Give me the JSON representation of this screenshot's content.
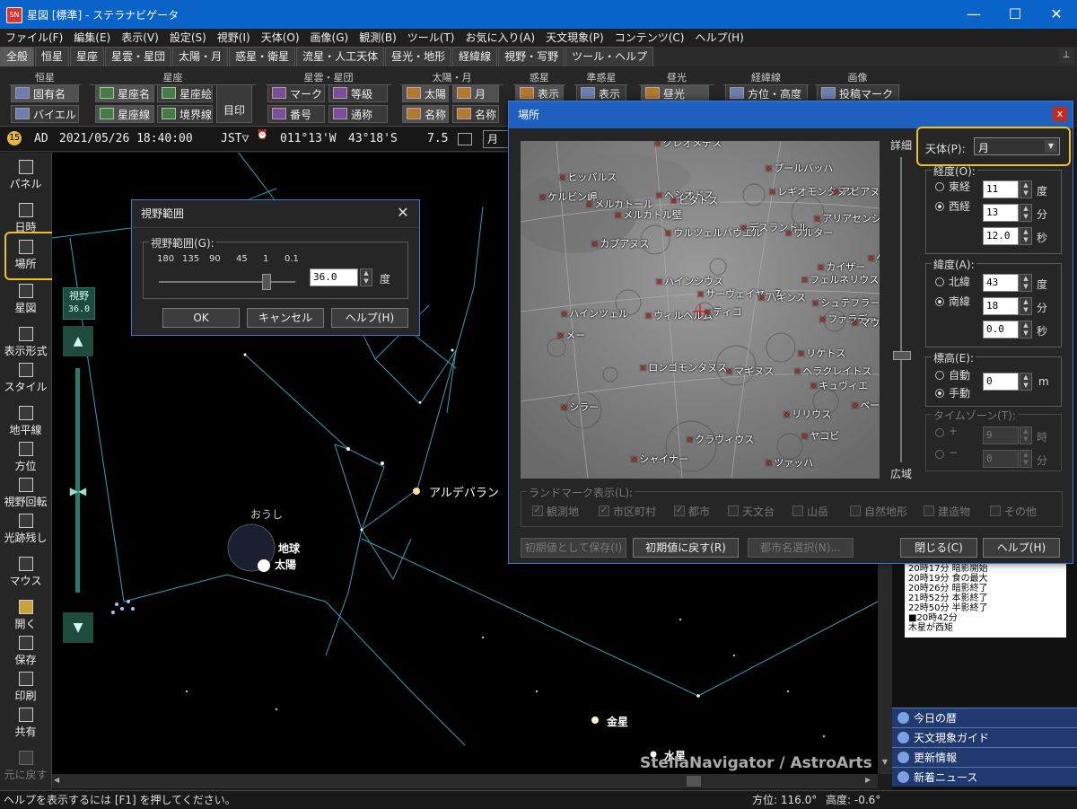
{
  "window": {
    "title": "星図 [標準] - ステラナビゲータ",
    "app_icon": "SN",
    "controls": [
      "—",
      "☐",
      "✕"
    ]
  },
  "menu": [
    "ファイル(F)",
    "編集(E)",
    "表示(V)",
    "設定(S)",
    "視野(I)",
    "天体(O)",
    "画像(G)",
    "観測(B)",
    "ツール(T)",
    "お気に入り(A)",
    "天文現象(P)",
    "コンテンツ(C)",
    "ヘルプ(H)"
  ],
  "tabs": [
    "全般",
    "恒星",
    "星座",
    "星雲・星団",
    "太陽・月",
    "惑星・衛星",
    "流星・人工天体",
    "昼光・地形",
    "経緯線",
    "視野・写野",
    "ツール・ヘルプ"
  ],
  "ribbon": {
    "groups": [
      "恒星",
      "星座",
      "星雲・星団",
      "太陽・月",
      "惑星",
      "準惑星",
      "昼光",
      "経緯線",
      "画像"
    ],
    "buttons": {
      "proper_name": "固有名",
      "bayer": "バイエル",
      "const_name": "星座名",
      "const_line": "星座線",
      "const_pic": "星座絵",
      "boundary": "境界線",
      "mark": "目印",
      "neb_mark": "マーク",
      "neb_number": "番号",
      "neb_grade": "等級",
      "neb_common": "通称",
      "sun": "太陽",
      "moon": "月",
      "sun_name": "名称",
      "moon_name": "名称",
      "planet_show": "表示",
      "dwarf_show": "表示",
      "daylight": "昼光",
      "azalt": "方位・高度",
      "post_mark": "投稿マーク"
    }
  },
  "datebar": {
    "era": "AD",
    "datetime": "2021/05/26 18:40:00",
    "tz": "JST▽",
    "lon": "011°13'W",
    "lat": "43°18'S",
    "mag": "7.5",
    "target": "月"
  },
  "left_toolbar": [
    {
      "label": "パネル"
    },
    {
      "label": "日時"
    },
    {
      "label": "場所"
    },
    {
      "label": "星図"
    },
    {
      "label": "表示形式"
    },
    {
      "label": "スタイル"
    },
    {
      "label": "地平線"
    },
    {
      "label": "方位"
    },
    {
      "label": "視野回転"
    },
    {
      "label": "光跡残し"
    },
    {
      "label": "マウス"
    },
    {
      "label": "開く"
    },
    {
      "label": "保存"
    },
    {
      "label": "印刷"
    },
    {
      "label": "共有"
    },
    {
      "label": "元に戻す"
    }
  ],
  "fov_slider": {
    "label": "視野",
    "value": "36.0"
  },
  "sky": {
    "labels": {
      "aldebaran": "アルデバラン",
      "ousi": "おうし",
      "earth": "地球",
      "sun": "太陽",
      "venus": "金星",
      "mercury": "水星",
      "watermark": "StellaNavigator / AstroArts"
    }
  },
  "fov_dialog": {
    "title": "視野範囲",
    "group": "視野範囲(G):",
    "scale": [
      "180",
      "135",
      "90",
      "45",
      "1",
      "0.1"
    ],
    "value": "36.0",
    "unit": "度",
    "slider_fraction": 0.8,
    "ok": "OK",
    "cancel": "キャンセル",
    "help": "ヘルプ(H)"
  },
  "place_dialog": {
    "title": "場所",
    "detail": "詳細",
    "wide": "広域",
    "body_label": "天体(P):",
    "body_value": "月",
    "lon_group": "経度(O):",
    "east": "東経",
    "west": "西経",
    "lon_deg": "11",
    "lon_min": "13",
    "lon_sec": "12.0",
    "deg": "度",
    "min": "分",
    "sec": "秒",
    "lat_group": "緯度(A):",
    "north": "北緯",
    "south": "南緯",
    "lat_deg": "43",
    "lat_min": "18",
    "lat_sec": "0.0",
    "elev_group": "標高(E):",
    "auto": "自動",
    "manual": "手動",
    "elev_value": "0",
    "elev_unit": "m",
    "tz_group": "タイムゾーン(T):",
    "tz_plus": "+",
    "tz_minus": "−",
    "tz_h": "9",
    "tz_m": "0",
    "hour": "時",
    "minute": "分",
    "landmark_group": "ランドマーク表示(L):",
    "landmarks": [
      {
        "label": "観測地",
        "checked": true
      },
      {
        "label": "市区町村",
        "checked": true
      },
      {
        "label": "都市",
        "checked": true
      },
      {
        "label": "天文台",
        "checked": false
      },
      {
        "label": "山岳",
        "checked": false
      },
      {
        "label": "自然地形",
        "checked": false
      },
      {
        "label": "建造物",
        "checked": false
      },
      {
        "label": "その他",
        "checked": false
      }
    ],
    "save_default": "初期値として保存(I)",
    "reset_default": "初期値に戻す(R)",
    "city_select": "都市名選択(N)...",
    "close": "閉じる(C)",
    "help": "ヘルプ(H)",
    "moon_features": [
      "クレオメデス",
      "ヒッパルス",
      "ケルビン岬",
      "メルカトール",
      "メルカトル壁",
      "ヘシオドス",
      "ピタトス",
      "カプアヌス",
      "ウルツェルバウエル",
      "プールバッハ",
      "レギオモンタヌス",
      "アピアヌス",
      "デスランドル",
      "ワルター",
      "アリアセンシス",
      "カイザー",
      "フェルネリウス",
      "ハインシウス",
      "ハインツェル",
      "サーヴェイヤー7",
      "ハギンス",
      "シュテフラー",
      "ファラデー",
      "マウロ",
      "ウィルヘルム",
      "ティコ",
      "メー",
      "リケトス",
      "ヘラクレイトス",
      "キュヴィエ",
      "ロンゴモンタヌス",
      "マギヌス",
      "シラー",
      "リリウス",
      "ベーコン",
      "クラヴィウス",
      "ヤコビ",
      "シャイナー",
      "ツァッハ",
      "ゲ"
    ]
  },
  "right_panel": {
    "events": [
      "20時17分 暗影開始",
      "20時19分 食の最大",
      "20時26分 暗影終了",
      "21時52分 本影終了",
      "22時50分 半影終了",
      "■20時42分",
      "木星が西矩"
    ],
    "items": [
      "今日の暦",
      "天文現象ガイド",
      "更新情報",
      "新着ニュース"
    ]
  },
  "statusbar": {
    "help": "ヘルプを表示するには [F1] を押してください。",
    "az": "方位: 116.0°",
    "alt": "高度: -0.6°"
  }
}
